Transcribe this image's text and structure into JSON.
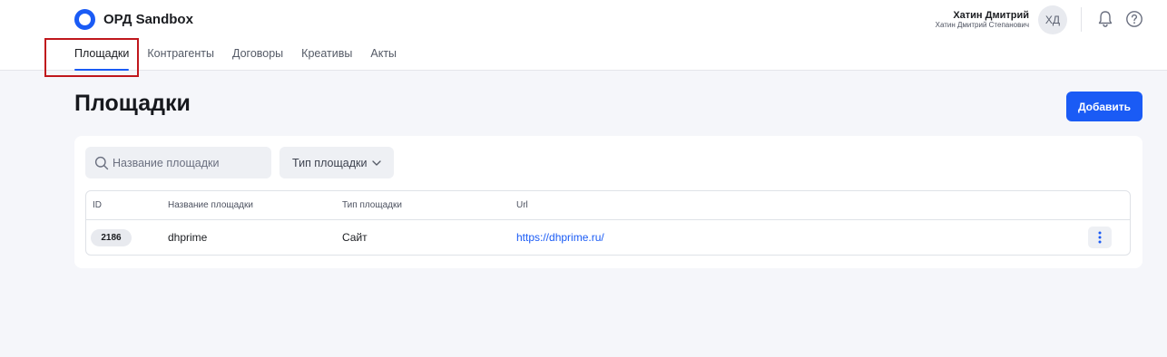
{
  "app": {
    "title": "ОРД Sandbox"
  },
  "user": {
    "name": "Хатин Дмитрий",
    "full_name": "Хатин Дмитрий Степанович",
    "initials": "ХД"
  },
  "nav": {
    "items": [
      {
        "label": "Площадки",
        "active": true
      },
      {
        "label": "Контрагенты",
        "active": false
      },
      {
        "label": "Договоры",
        "active": false
      },
      {
        "label": "Креативы",
        "active": false
      },
      {
        "label": "Акты",
        "active": false
      }
    ]
  },
  "page": {
    "title": "Площадки",
    "add_label": "Добавить"
  },
  "filters": {
    "search_placeholder": "Название площадки",
    "type_label": "Тип площадки"
  },
  "table": {
    "columns": [
      "ID",
      "Название площадки",
      "Тип площадки",
      "Url"
    ],
    "rows": [
      {
        "id": "2186",
        "name": "dhprime",
        "type": "Сайт",
        "url": "https://dhprime.ru/"
      }
    ]
  },
  "colors": {
    "accent": "#1a5bf5",
    "highlight": "#c0171c",
    "background": "#f5f6fa"
  },
  "icons": [
    "logo-icon",
    "bell-icon",
    "help-icon",
    "search-icon",
    "chevron-down-icon",
    "more-vertical-icon"
  ]
}
